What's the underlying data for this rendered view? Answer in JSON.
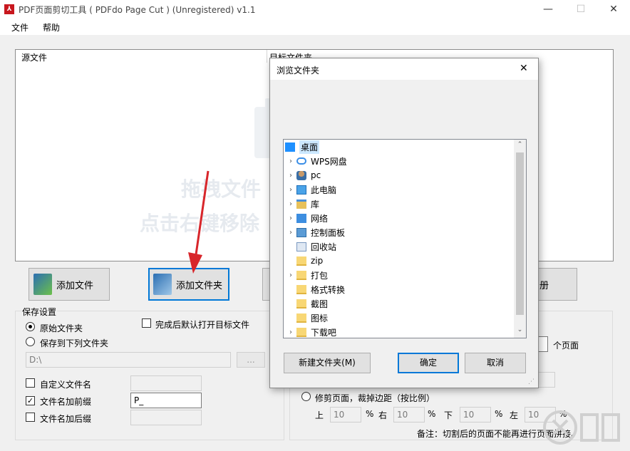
{
  "window": {
    "title": "PDF页面剪切工具 ( PDFdo Page Cut ) (Unregistered) v1.1",
    "app_icon_glyph": "⅄",
    "minimize_glyph": "—",
    "maximize_glyph": "☐",
    "close_glyph": "✕"
  },
  "menu": {
    "file": "文件",
    "help": "帮助"
  },
  "list": {
    "col_source": "源文件",
    "col_target": "目标文件夹",
    "watermark_line1": "拖拽文件",
    "watermark_line2": "点击右键移除"
  },
  "buttons": {
    "add_file": "添加文件",
    "add_folder": "添加文件夹",
    "register_partial": "册"
  },
  "save_settings": {
    "title": "保存设置",
    "original_folder": "原始文件夹",
    "save_to_folder": "保存到下列文件夹",
    "open_after": "完成后默认打开目标文件",
    "path_value": "D:\\",
    "browse_label": "...",
    "custom_name": "自定义文件名",
    "prefix": "文件名加前缀",
    "prefix_value": "P_",
    "suffix": "文件名加后缀"
  },
  "cut_settings": {
    "pages_suffix": "个页面",
    "trim_option": "修剪页面，裁掉边距（按比例）",
    "top": "上",
    "right": "右",
    "bottom": "下",
    "left": "左",
    "top_value": "10",
    "right_value": "10",
    "bottom_value": "10",
    "left_value": "10",
    "percent": "%",
    "note": "备注：切割后的页面不能再进行页面拼接。"
  },
  "dialog": {
    "title": "浏览文件夹",
    "close_glyph": "✕",
    "tree": [
      {
        "label": "桌面",
        "icon": "desktop-icon",
        "expandable": false,
        "selected": true,
        "indent": 0
      },
      {
        "label": "WPS网盘",
        "icon": "cloud-icon",
        "expandable": true,
        "indent": 1
      },
      {
        "label": "pc",
        "icon": "user-icon",
        "expandable": true,
        "indent": 1
      },
      {
        "label": "此电脑",
        "icon": "computer-icon",
        "expandable": true,
        "indent": 1
      },
      {
        "label": "库",
        "icon": "library-icon",
        "expandable": true,
        "indent": 1
      },
      {
        "label": "网络",
        "icon": "network-icon",
        "expandable": true,
        "indent": 1
      },
      {
        "label": "控制面板",
        "icon": "control-panel-icon",
        "expandable": true,
        "indent": 1
      },
      {
        "label": "回收站",
        "icon": "recycle-bin-icon",
        "expandable": false,
        "indent": 1
      },
      {
        "label": "zip",
        "icon": "folder-icon",
        "expandable": false,
        "indent": 1
      },
      {
        "label": "打包",
        "icon": "folder-icon",
        "expandable": true,
        "indent": 1
      },
      {
        "label": "格式转换",
        "icon": "folder-icon",
        "expandable": false,
        "indent": 1
      },
      {
        "label": "截图",
        "icon": "folder-icon",
        "expandable": false,
        "indent": 1
      },
      {
        "label": "图标",
        "icon": "folder-icon",
        "expandable": false,
        "indent": 1
      },
      {
        "label": "下载吧",
        "icon": "folder-icon",
        "expandable": true,
        "indent": 1
      }
    ],
    "new_folder": "新建文件夹(M)",
    "ok": "确定",
    "cancel": "取消"
  },
  "colors": {
    "accent": "#0078d7",
    "arrow": "#d8262b",
    "selection": "#cce8ff"
  }
}
